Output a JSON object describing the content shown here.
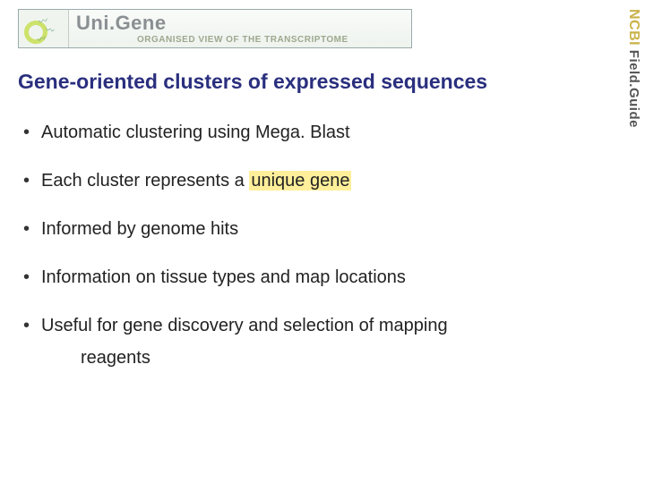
{
  "banner": {
    "brand_prefix": "Uni.",
    "brand_suffix": "Gene",
    "tagline": "ORGANISED VIEW OF THE TRANSCRIPTOME"
  },
  "sidelabel": {
    "bold": "NCBI",
    "rest": " Field.Guide"
  },
  "title": "Gene-oriented clusters of expressed sequences",
  "bullets": {
    "b1": "Automatic clustering using Mega. Blast",
    "b2_pre": "Each cluster represents a ",
    "b2_hl": "unique gene",
    "b3": "Informed by genome hits",
    "b4": "Information on tissue types and map locations",
    "b5_line1": "Useful for gene discovery and selection of mapping",
    "b5_line2": "reagents"
  }
}
